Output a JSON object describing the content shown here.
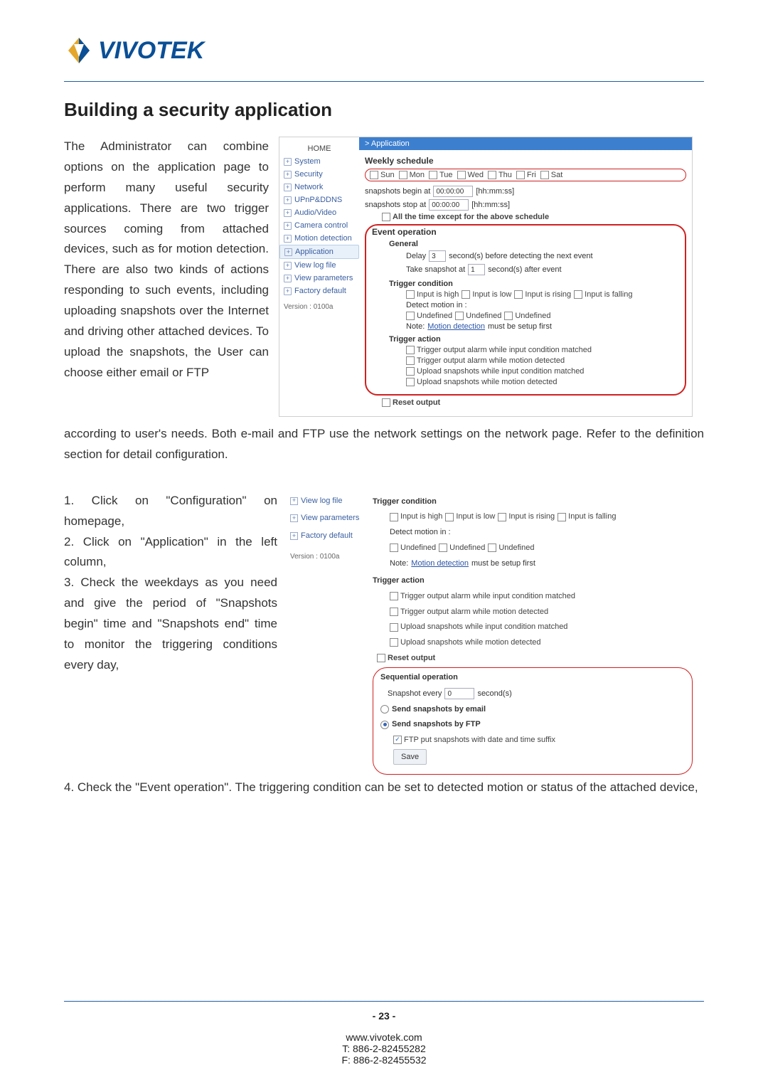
{
  "brand": "VIVOTEK",
  "heading": "Building a security application",
  "intro_left": "The Administrator can combine options on the application page to perform many useful security applications. There are two trigger sources coming from attached devices, such as for motion detection. There are also two kinds of actions responding to such events, including uploading snapshots over the Internet and driving other attached devices. To upload the snapshots, the User can choose either email or FTP",
  "intro_cont": "according to user's needs. Both e-mail and FTP use the network settings on the network page. Refer to the definition section for detail configuration.",
  "steps": {
    "s1": "1. Click on \"Configuration\" on homepage,",
    "s2": "2. Click on \"Application\" in the left column,",
    "s3": "3. Check the weekdays as you need and give the period of \"Snapshots begin\" time and \"Snapshots end\" time to monitor the triggering conditions every day,",
    "s4": "4. Check the \"Event operation\". The triggering condition can be set to detected motion or status of the attached device,"
  },
  "footer": {
    "page": "- 23 -",
    "url": "www.vivotek.com",
    "tel": "T: 886-2-82455282",
    "fax": "F: 886-2-82455532"
  },
  "shot1": {
    "nav": {
      "home": "HOME",
      "items": [
        "System",
        "Security",
        "Network",
        "UPnP&DDNS",
        "Audio/Video",
        "Camera control",
        "Motion detection",
        "Application",
        "View log file",
        "View parameters",
        "Factory default"
      ],
      "selected": "Application",
      "version": "Version : 0100a"
    },
    "titlebar": "> Application",
    "weekly": {
      "title": "Weekly schedule",
      "days": [
        "Sun",
        "Mon",
        "Tue",
        "Wed",
        "Thu",
        "Fri",
        "Sat"
      ],
      "begin_label": "snapshots begin at",
      "begin_value": "00:00:00",
      "begin_hint": "[hh:mm:ss]",
      "stop_label": "snapshots stop at",
      "stop_value": "00:00:00",
      "stop_hint": "[hh:mm:ss]",
      "all_time": "All the time except for the above schedule"
    },
    "event": {
      "title": "Event operation",
      "general": "General",
      "delay_label": "Delay",
      "delay_value": "3",
      "delay_suffix": "second(s) before detecting the next event",
      "snap_label": "Take snapshot at",
      "snap_value": "1",
      "snap_suffix": "second(s) after event",
      "tc_title": "Trigger condition",
      "tc_opts": [
        "Input is high",
        "Input is low",
        "Input is rising",
        "Input is falling"
      ],
      "detect_in": "Detect motion in :",
      "undef": "Undefined",
      "note_pre": "Note: ",
      "note_link": "Motion detection",
      "note_post": " must be setup first",
      "ta_title": "Trigger action",
      "ta_opts": [
        "Trigger output alarm while input condition matched",
        "Trigger output alarm while motion detected",
        "Upload snapshots while input condition matched",
        "Upload snapshots while motion detected"
      ],
      "reset": "Reset output"
    }
  },
  "shot2": {
    "nav": {
      "items": [
        "View log file",
        "View parameters",
        "Factory default"
      ],
      "version": "Version : 0100a"
    },
    "tc_title": "Trigger condition",
    "tc_opts": [
      "Input is high",
      "Input is low",
      "Input is rising",
      "Input is falling"
    ],
    "detect_in": "Detect motion in :",
    "undef": "Undefined",
    "note_pre": "Note: ",
    "note_link": "Motion detection",
    "note_post": " must be setup first",
    "ta_title": "Trigger action",
    "ta_opts": [
      "Trigger output alarm while input condition matched",
      "Trigger output alarm while motion detected",
      "Upload snapshots while input condition matched",
      "Upload snapshots while motion detected"
    ],
    "reset": "Reset output",
    "seq_title": "Sequential operation",
    "seq_label": "Snapshot every",
    "seq_value": "0",
    "seq_suffix": "second(s)",
    "send_email": "Send snapshots by email",
    "send_ftp": "Send snapshots by FTP",
    "ftp_suffix": "FTP put snapshots with date and time suffix",
    "save": "Save"
  }
}
